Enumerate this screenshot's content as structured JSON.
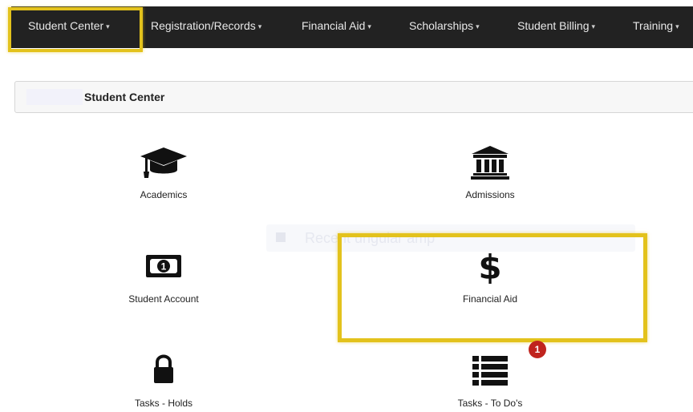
{
  "nav": {
    "items": [
      {
        "label": "Student Center",
        "icon": "caret-down-icon"
      },
      {
        "label": "Registration/Records",
        "icon": "caret-down-icon"
      },
      {
        "label": "Financial Aid",
        "icon": "caret-down-icon"
      },
      {
        "label": "Scholarships",
        "icon": "caret-down-icon"
      },
      {
        "label": "Student Billing",
        "icon": "caret-down-icon"
      },
      {
        "label": "Training",
        "icon": "caret-down-icon"
      }
    ],
    "highlight_color": "#e3c21c"
  },
  "breadcrumb": {
    "title": "Student Center"
  },
  "tiles": [
    {
      "label": "Academics",
      "icon": "graduation-cap-icon"
    },
    {
      "label": "Admissions",
      "icon": "institution-icon"
    },
    {
      "label": "Student Account",
      "icon": "money-bill-icon"
    },
    {
      "label": "Financial Aid",
      "icon": "dollar-icon"
    },
    {
      "label": "Tasks - Holds",
      "icon": "lock-icon"
    },
    {
      "label": "Tasks - To Do's",
      "icon": "list-icon",
      "badge": "1"
    }
  ],
  "ghost_toast": {
    "text": "Recent ungular amp"
  },
  "colors": {
    "nav_bg": "#222222",
    "highlight": "#e3c21c",
    "badge": "#c0241e"
  }
}
